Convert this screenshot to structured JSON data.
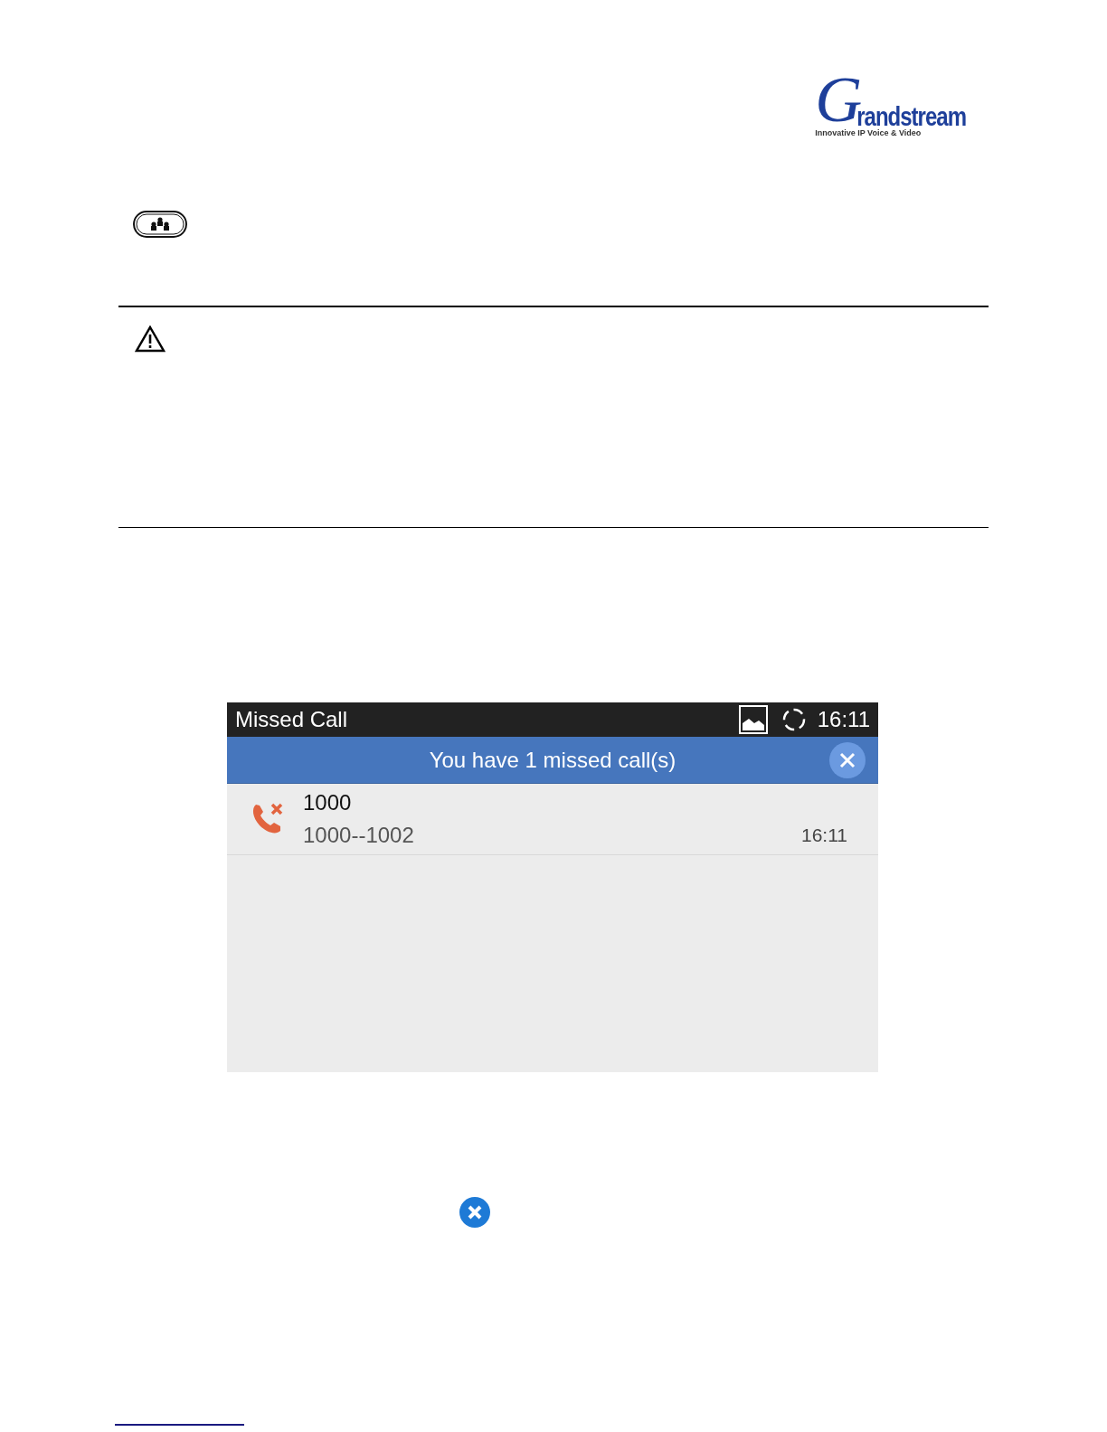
{
  "logo": {
    "initial": "G",
    "name": "randstream",
    "tagline": "Innovative IP Voice & Video"
  },
  "screen": {
    "title": "Missed Call",
    "clock": "16:11",
    "banner": "You have 1 missed call(s)",
    "calls": [
      {
        "name": "1000",
        "detail": "1000--1002",
        "time": "16:11"
      }
    ]
  }
}
